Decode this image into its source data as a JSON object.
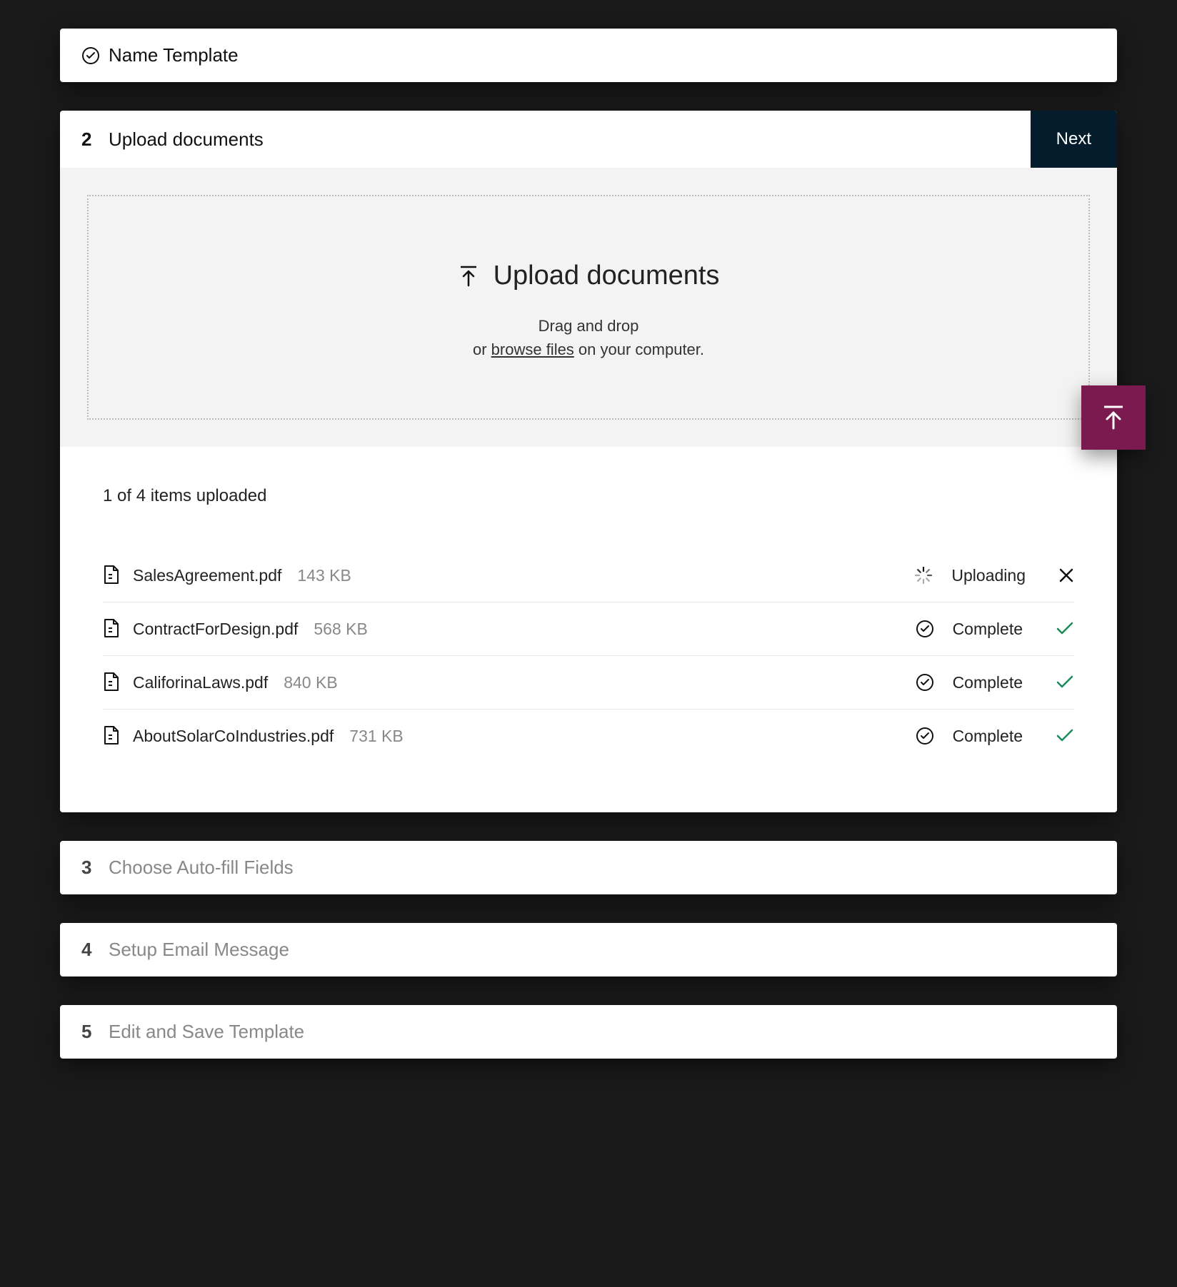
{
  "steps": {
    "s1": {
      "title": "Name Template",
      "complete": true
    },
    "s2": {
      "number": "2",
      "title": "Upload documents",
      "nextLabel": "Next"
    },
    "s3": {
      "number": "3",
      "title": "Choose Auto-fill Fields"
    },
    "s4": {
      "number": "4",
      "title": "Setup Email Message"
    },
    "s5": {
      "number": "5",
      "title": "Edit and Save Template"
    }
  },
  "dropzone": {
    "title": "Upload documents",
    "line1": "Drag and drop",
    "line2a": "or ",
    "browse": "browse files",
    "line2b": " on your computer."
  },
  "uploads": {
    "header": "1 of 4 items uploaded",
    "statusUploading": "Uploading",
    "statusComplete": "Complete",
    "files": [
      {
        "name": "SalesAgreement.pdf",
        "size": "143 KB",
        "status": "uploading"
      },
      {
        "name": "ContractForDesign.pdf",
        "size": "568 KB",
        "status": "complete"
      },
      {
        "name": "CaliforinaLaws.pdf",
        "size": "840 KB",
        "status": "complete"
      },
      {
        "name": "AboutSolarCoIndustries.pdf",
        "size": "731 KB",
        "status": "complete"
      }
    ]
  },
  "colors": {
    "accent": "#7a1a4f",
    "darkButton": "#051c2c",
    "success": "#1a8a5a"
  }
}
